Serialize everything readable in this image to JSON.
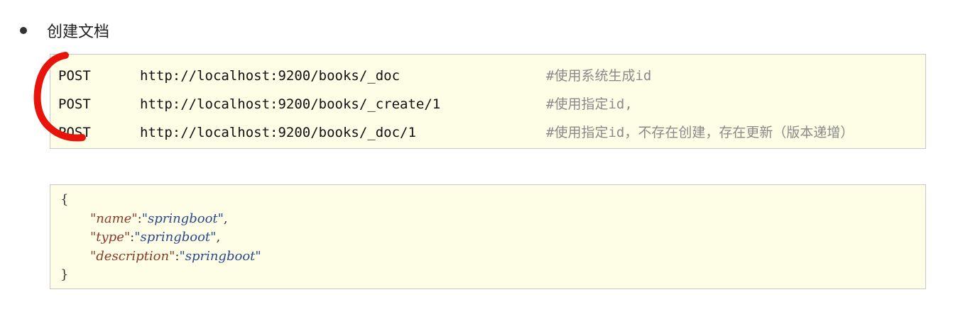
{
  "section": {
    "title": "创建文档"
  },
  "requests": [
    {
      "method": "POST",
      "url": "http://localhost:9200/books/_doc",
      "comment": "#使用系统生成id"
    },
    {
      "method": "POST",
      "url": "http://localhost:9200/books/_create/1",
      "comment": "#使用指定id,"
    },
    {
      "method": "POST",
      "url": "http://localhost:9200/books/_doc/1",
      "comment": "#使用指定id，不存在创建，存在更新（版本递增）"
    }
  ],
  "body": {
    "open_brace": "{",
    "close_brace": "}",
    "fields": [
      {
        "key": "\"name\"",
        "sep": ":",
        "value": "\"springboot\"",
        "trail": ","
      },
      {
        "key": "\"type\"",
        "sep": ":",
        "value": "\"springboot\"",
        "trail": ","
      },
      {
        "key": "\"description\"",
        "sep": ":",
        "value": "\"springboot\"",
        "trail": ""
      }
    ]
  },
  "colors": {
    "code_background": "#fefde6",
    "code_border": "#c8c8c8",
    "annotation_stroke": "#e8140c",
    "comment_text": "#8a8a8a"
  }
}
